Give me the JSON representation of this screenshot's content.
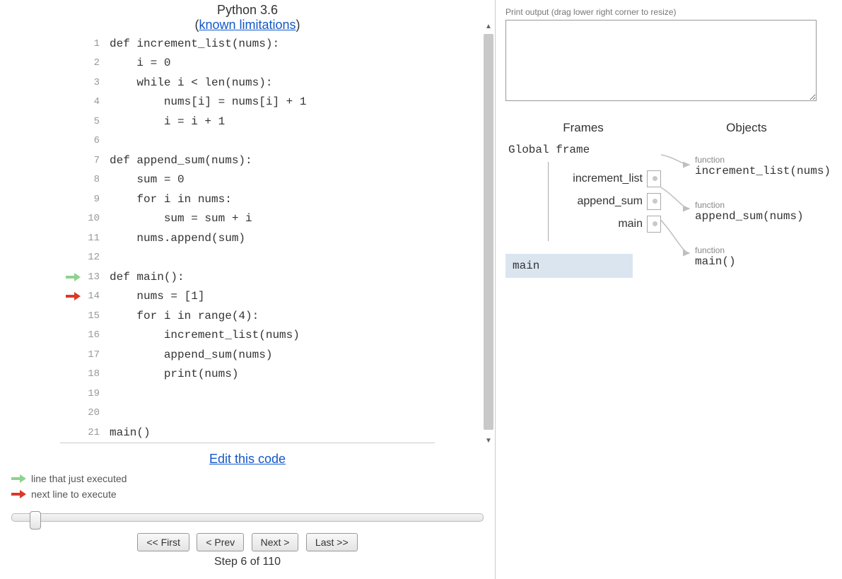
{
  "header": {
    "language": "Python 3.6",
    "limitations_prefix": "(",
    "limitations_link": "known limitations",
    "limitations_suffix": ")"
  },
  "code": {
    "lines": [
      {
        "n": 1,
        "text": "def increment_list(nums):",
        "arrow": null
      },
      {
        "n": 2,
        "text": "    i = 0",
        "arrow": null
      },
      {
        "n": 3,
        "text": "    while i < len(nums):",
        "arrow": null
      },
      {
        "n": 4,
        "text": "        nums[i] = nums[i] + 1",
        "arrow": null
      },
      {
        "n": 5,
        "text": "        i = i + 1",
        "arrow": null
      },
      {
        "n": 6,
        "text": "",
        "arrow": null
      },
      {
        "n": 7,
        "text": "def append_sum(nums):",
        "arrow": null
      },
      {
        "n": 8,
        "text": "    sum = 0",
        "arrow": null
      },
      {
        "n": 9,
        "text": "    for i in nums:",
        "arrow": null
      },
      {
        "n": 10,
        "text": "        sum = sum + i",
        "arrow": null
      },
      {
        "n": 11,
        "text": "    nums.append(sum)",
        "arrow": null
      },
      {
        "n": 12,
        "text": "",
        "arrow": null
      },
      {
        "n": 13,
        "text": "def main():",
        "arrow": "green"
      },
      {
        "n": 14,
        "text": "    nums = [1]",
        "arrow": "red"
      },
      {
        "n": 15,
        "text": "    for i in range(4):",
        "arrow": null
      },
      {
        "n": 16,
        "text": "        increment_list(nums)",
        "arrow": null
      },
      {
        "n": 17,
        "text": "        append_sum(nums)",
        "arrow": null
      },
      {
        "n": 18,
        "text": "        print(nums)",
        "arrow": null
      },
      {
        "n": 19,
        "text": "",
        "arrow": null
      },
      {
        "n": 20,
        "text": "",
        "arrow": null
      },
      {
        "n": 21,
        "text": "main()",
        "arrow": null
      }
    ]
  },
  "edit_link": "Edit this code",
  "legend": {
    "just_executed": "line that just executed",
    "next_line": "next line to execute"
  },
  "controls": {
    "first": "<< First",
    "prev": "< Prev",
    "next": "Next >",
    "last": "Last >>"
  },
  "step": {
    "current": 6,
    "total": 110,
    "text": "Step 6 of 110"
  },
  "output": {
    "label": "Print output (drag lower right corner to resize)",
    "value": ""
  },
  "frames_header": {
    "frames": "Frames",
    "objects": "Objects"
  },
  "frames": {
    "global_title": "Global frame",
    "vars": [
      {
        "name": "increment_list"
      },
      {
        "name": "append_sum"
      },
      {
        "name": "main"
      }
    ],
    "call_frame": "main"
  },
  "objects": [
    {
      "label": "function",
      "sig": "increment_list(nums)"
    },
    {
      "label": "function",
      "sig": "append_sum(nums)"
    },
    {
      "label": "function",
      "sig": "main()"
    }
  ]
}
